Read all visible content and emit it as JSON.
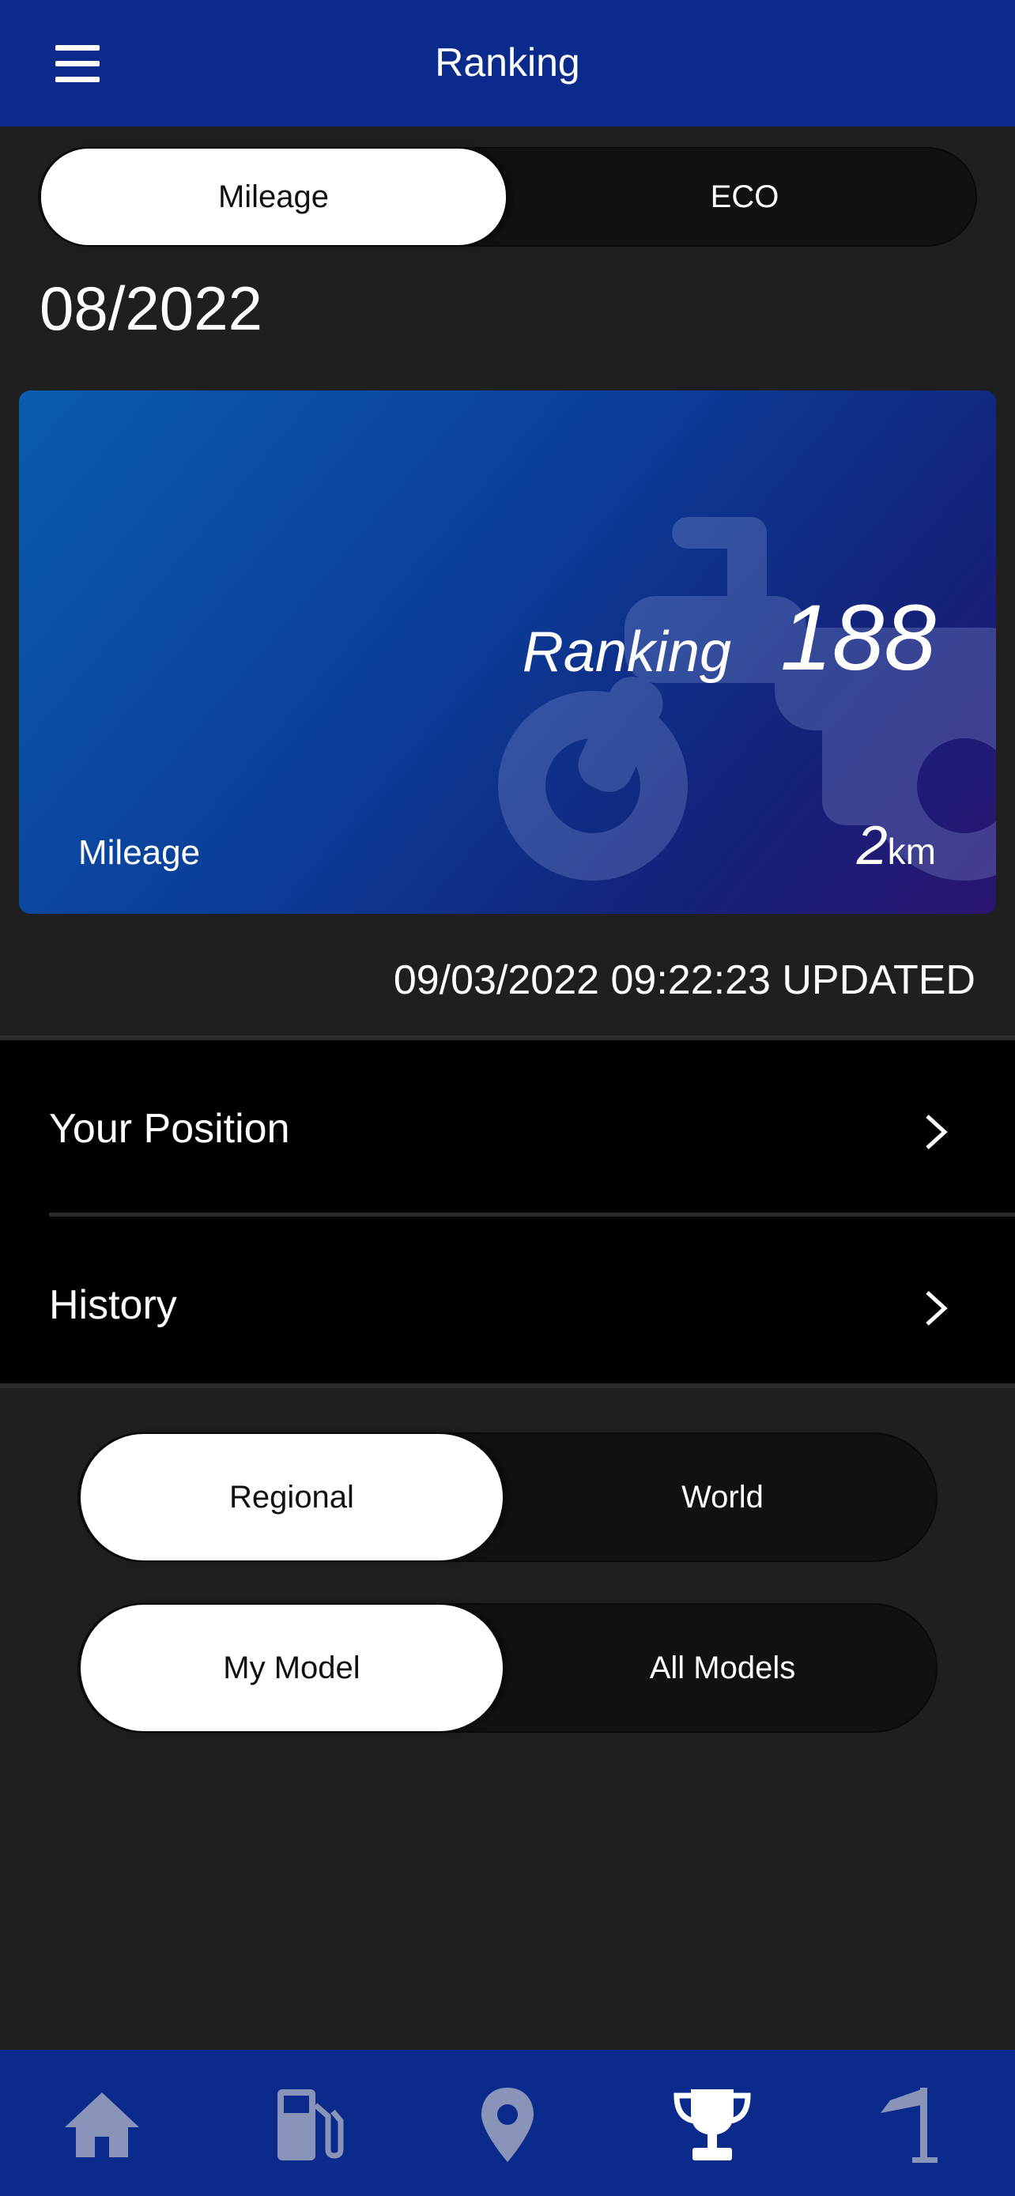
{
  "header": {
    "title": "Ranking"
  },
  "top_segment": {
    "options": [
      "Mileage",
      "ECO"
    ],
    "selected": "Mileage"
  },
  "period": "08/2022",
  "card": {
    "rank_label": "Ranking",
    "rank_value": "188",
    "metric_label": "Mileage",
    "metric_value": "2",
    "metric_unit": "km"
  },
  "updated_text": "09/03/2022 09:22:23 UPDATED",
  "list": [
    {
      "label": "Your Position"
    },
    {
      "label": "History"
    }
  ],
  "scope_segment": {
    "options": [
      "Regional",
      "World"
    ],
    "selected": "Regional"
  },
  "model_segment": {
    "options": [
      "My Model",
      "All Models"
    ],
    "selected": "My Model"
  },
  "tabbar": {
    "items": [
      "home-icon",
      "fuel-icon",
      "location-pin-icon",
      "trophy-icon",
      "flag-icon"
    ],
    "active": "trophy-icon",
    "active_color": "#ffffff",
    "inactive_color": "#8a93b8"
  },
  "colors": {
    "header": "#0a2a8c",
    "background": "#1f1f1f"
  }
}
